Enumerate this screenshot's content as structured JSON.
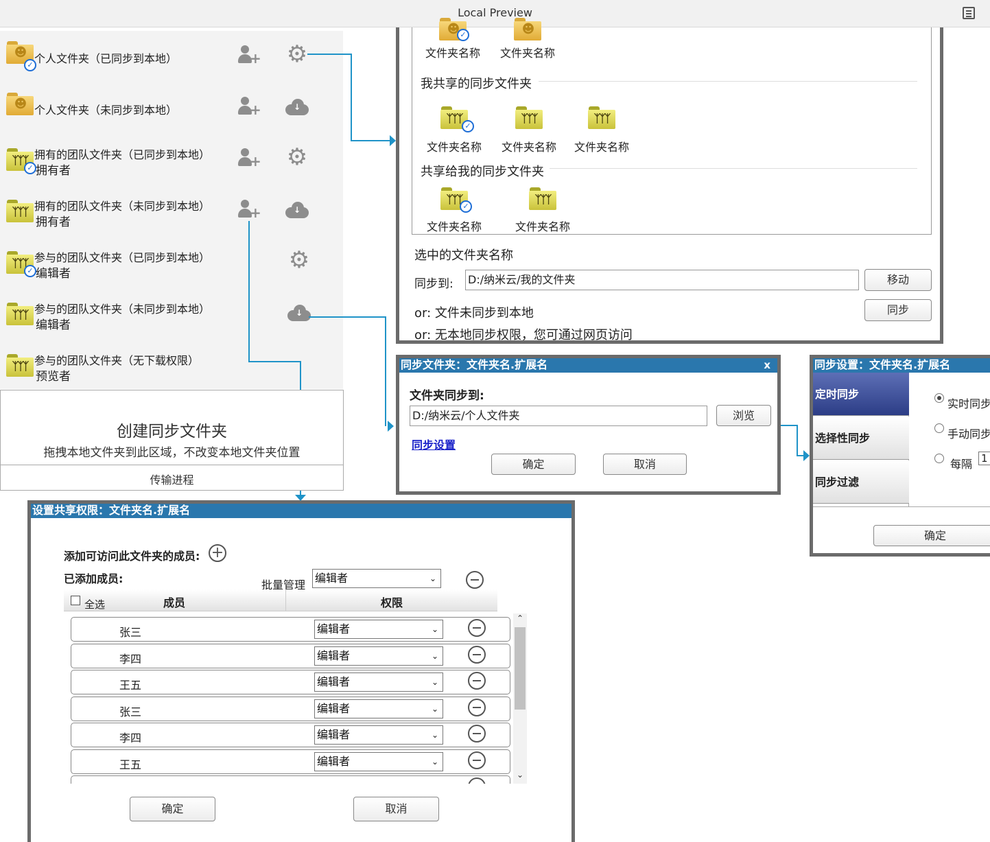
{
  "window": {
    "title": "Local Preview"
  },
  "folder_list": {
    "rows": [
      {
        "label": "个人文件夹（已同步到本地）",
        "role": "",
        "type": "personal",
        "synced": true,
        "add": true,
        "action": "gear"
      },
      {
        "label": "个人文件夹（未同步到本地）",
        "role": "",
        "type": "personal",
        "synced": false,
        "add": true,
        "action": "download"
      },
      {
        "label": "拥有的团队文件夹（已同步到本地）",
        "role": "拥有者",
        "type": "team",
        "synced": true,
        "add": true,
        "action": "gear"
      },
      {
        "label": "拥有的团队文件夹（未同步到本地）",
        "role": "拥有者",
        "type": "team",
        "synced": false,
        "add": true,
        "action": "download"
      },
      {
        "label": "参与的团队文件夹（已同步到本地）",
        "role": "编辑者",
        "type": "team",
        "synced": true,
        "add": false,
        "action": "gear"
      },
      {
        "label": "参与的团队文件夹（未同步到本地）",
        "role": "编辑者",
        "type": "team",
        "synced": false,
        "add": false,
        "action": "download"
      },
      {
        "label": "参与的团队文件夹（无下载权限）",
        "role": "预览者",
        "type": "team",
        "synced": false,
        "add": false,
        "action": "none"
      }
    ]
  },
  "drop_zone": {
    "title": "创建同步文件夹",
    "subtitle": "拖拽本地文件夹到此区域，不改变本地文件夹位置",
    "transfer": "传输进程"
  },
  "browser": {
    "top_folders": [
      "文件夹名称",
      "文件夹名称"
    ],
    "shared_by_me_title": "我共享的同步文件夹",
    "shared_by_me": [
      "文件夹名称",
      "文件夹名称",
      "文件夹名称"
    ],
    "shared_to_me_title": "共享给我的同步文件夹",
    "shared_to_me": [
      "文件夹名称",
      "文件夹名称"
    ],
    "selected_name": "选中的文件夹名称",
    "sync_to_label": "同步到:",
    "sync_to_value": "D:/纳米云/我的文件夹",
    "move_button": "移动",
    "sync_button": "同步",
    "or_not_synced": "or:  文件未同步到本地",
    "or_no_permission": "or:  无本地同步权限，您可通过网页访问"
  },
  "sync_folder_dialog": {
    "title": "同步文件夹：文件夹名.扩展名",
    "close": "x",
    "label": "文件夹同步到:",
    "path": "D:/纳米云/个人文件夹",
    "browse": "浏览",
    "settings_link": "同步设置",
    "ok": "确定",
    "cancel": "取消"
  },
  "sync_settings_dialog": {
    "title": "同步设置：文件夹名.扩展名",
    "tabs": [
      "定时同步",
      "选择性同步",
      "同步过滤"
    ],
    "options": [
      "实时同步",
      "手动同步",
      "每隔"
    ],
    "interval_value": "1",
    "ok": "确定"
  },
  "share_dialog": {
    "title": "设置共享权限：文件夹名.扩展名",
    "add_members_label": "添加可访问此文件夹的成员:",
    "added_members_label": "已添加成员:",
    "bulk_manage_label": "批量管理",
    "bulk_value": "编辑者",
    "select_all": "全选",
    "col_member": "成员",
    "col_permission": "权限",
    "members": [
      {
        "name": "张三",
        "role": "编辑者"
      },
      {
        "name": "李四",
        "role": "编辑者"
      },
      {
        "name": "王五",
        "role": "编辑者"
      },
      {
        "name": "张三",
        "role": "编辑者"
      },
      {
        "name": "李四",
        "role": "编辑者"
      },
      {
        "name": "王五",
        "role": "编辑者"
      }
    ],
    "ok": "确定",
    "cancel": "取消"
  },
  "colors": {
    "dialog_header": "#2a77ad",
    "connector": "#1f93c8",
    "active_tab": "#2c3d86",
    "check_badge": "#1e6ed6"
  }
}
